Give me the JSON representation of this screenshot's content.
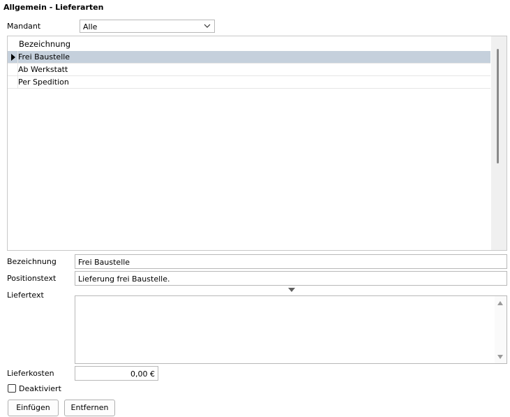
{
  "title": "Allgemein - Lieferarten",
  "mandant": {
    "label": "Mandant",
    "value": "Alle"
  },
  "grid": {
    "header": "Bezeichnung",
    "rows": [
      "Frei Baustelle",
      "Ab Werkstatt",
      "Per Spedition"
    ],
    "selected_index": 0
  },
  "form": {
    "bezeichnung_label": "Bezeichnung",
    "bezeichnung_value": "Frei Baustelle",
    "positionstext_label": "Positionstext",
    "positionstext_value": "Lieferung frei Baustelle.",
    "liefertext_label": "Liefertext",
    "liefertext_value": "",
    "lieferkosten_label": "Lieferkosten",
    "lieferkosten_value": "0,00 €",
    "deaktiviert_label": "Deaktiviert",
    "deaktiviert_checked": false
  },
  "buttons": {
    "insert": "Einfügen",
    "remove": "Entfernen"
  },
  "colors": {
    "selected_row": "#c5d0dc",
    "border": "#b8b8b8"
  }
}
